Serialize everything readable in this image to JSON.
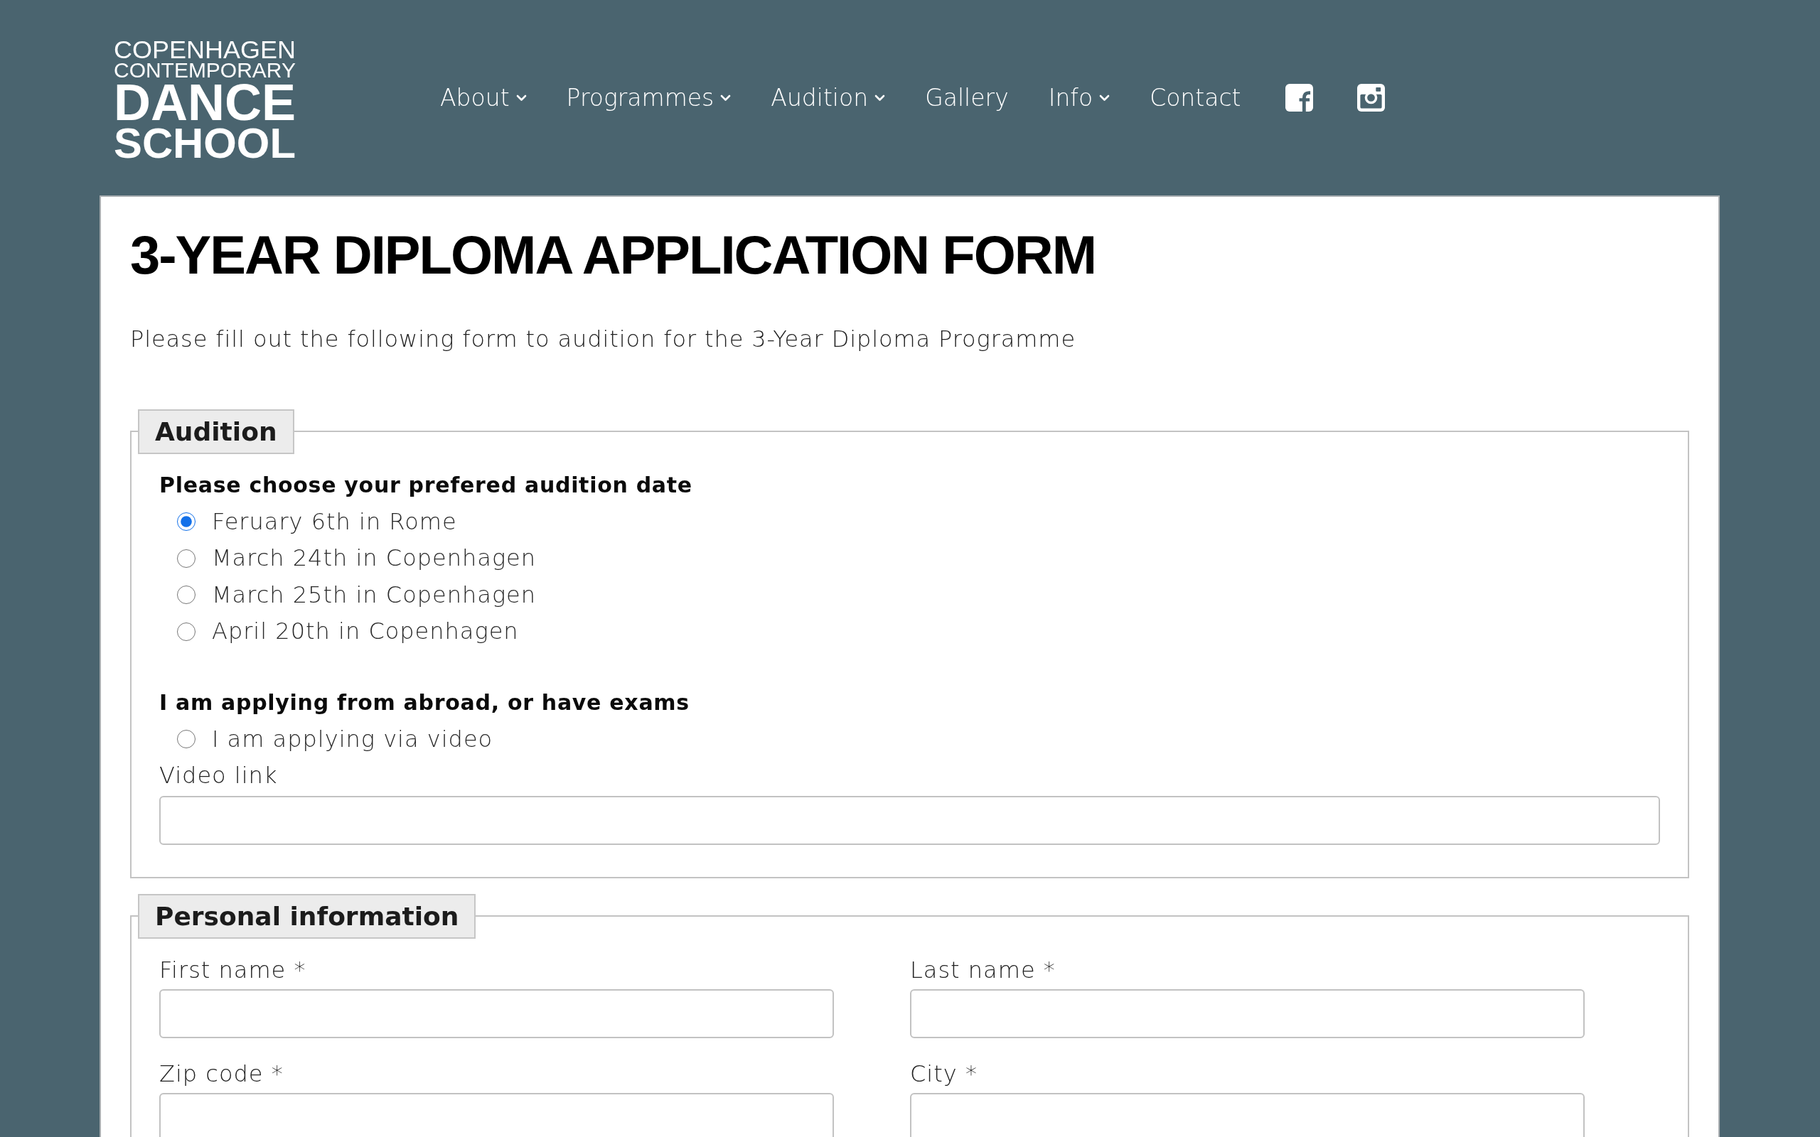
{
  "header": {
    "logo": [
      {
        "text": "COPENHAGEN",
        "kind": "small"
      },
      {
        "text": "CONTEMPORARY",
        "kind": "small"
      },
      {
        "text": "DANCE",
        "kind": "large"
      },
      {
        "text": "SCHOOL",
        "kind": "large"
      }
    ],
    "nav": [
      {
        "label": "About",
        "dropdown": true
      },
      {
        "label": "Programmes",
        "dropdown": true
      },
      {
        "label": "Audition",
        "dropdown": true
      },
      {
        "label": "Gallery",
        "dropdown": false
      },
      {
        "label": "Info",
        "dropdown": true
      },
      {
        "label": "Contact",
        "dropdown": false
      }
    ],
    "social": [
      {
        "kind": "facebook"
      },
      {
        "kind": "instagram"
      }
    ]
  },
  "page": {
    "title": "3-YEAR DIPLOMA APPLICATION FORM",
    "intro": "Please fill out the following form to audition for the 3-Year Diploma Programme"
  },
  "sections": [
    {
      "legend": "Audition",
      "groups": [
        {
          "kind": "radio_group",
          "heading": "Please choose your prefered audition date",
          "options": [
            {
              "label": "Feruary 6th in Rome",
              "selected": true
            },
            {
              "label": "March 24th in Copenhagen",
              "selected": false
            },
            {
              "label": "March 25th in Copenhagen",
              "selected": false
            },
            {
              "label": "April 20th in Copenhagen",
              "selected": false
            }
          ]
        },
        {
          "kind": "radio_group",
          "heading": "I am applying from abroad, or have exams",
          "options": [
            {
              "label": "I am applying via video",
              "selected": false
            }
          ]
        },
        {
          "kind": "text_field",
          "label": "Video link"
        }
      ]
    },
    {
      "legend": "Personal information",
      "groups": [
        {
          "kind": "field_grid",
          "fields": [
            {
              "label": "First name *"
            },
            {
              "label": "Last name *"
            },
            {
              "label": "Zip code *"
            },
            {
              "label": "City *"
            }
          ]
        }
      ]
    }
  ]
}
